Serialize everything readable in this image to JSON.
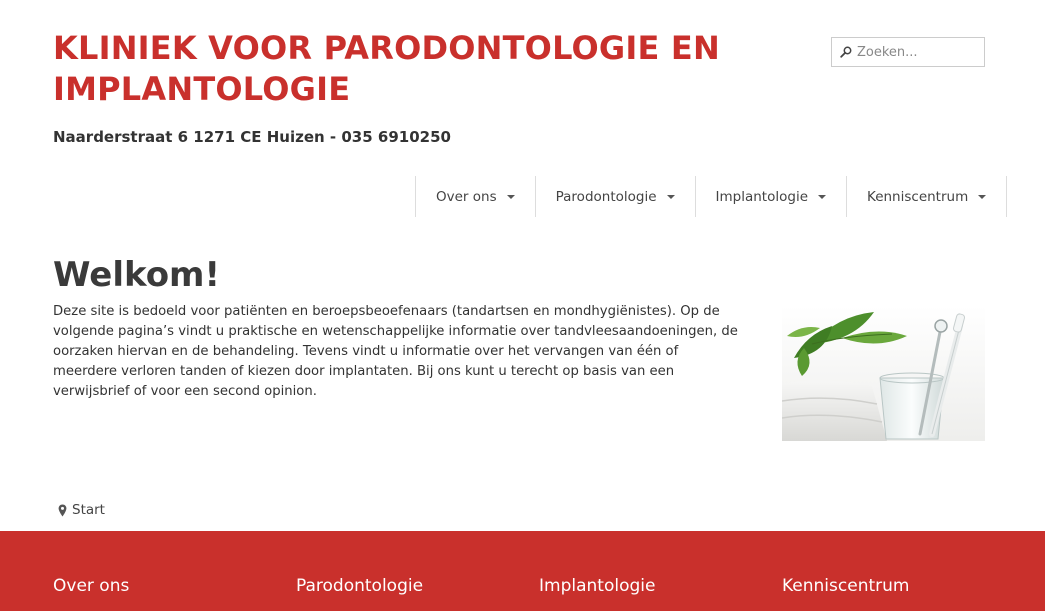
{
  "header": {
    "title": "KLINIEK VOOR PARODONTOLOGIE EN IMPLANTOLOGIE",
    "address": "Naarderstraat 6 1271 CE Huizen - 035 6910250"
  },
  "search": {
    "placeholder": "Zoeken...",
    "icon": "search-icon"
  },
  "nav": {
    "items": [
      {
        "label": "Over ons",
        "icon": "caret-down-icon"
      },
      {
        "label": "Parodontologie",
        "icon": "caret-down-icon"
      },
      {
        "label": "Implantologie",
        "icon": "caret-down-icon"
      },
      {
        "label": "Kenniscentrum",
        "icon": "caret-down-icon"
      }
    ]
  },
  "main": {
    "heading": "Welkom!",
    "intro": "Deze site is bedoeld voor patiënten en beroepsbeoefenaars (tandartsen en mondhygiënistes). Op de volgende pagina’s vindt u praktische en wetenschappelijke informatie over tandvleesaandoeningen, de oorzaken hiervan en de behandeling. Tevens vindt u informatie over het vervangen van één of meerdere verloren tanden of kiezen door implantaten. Bij ons kunt u terecht op basis van een verwijsbrief of voor een second opinion."
  },
  "breadcrumb": {
    "label": "Start",
    "icon": "map-marker-icon"
  },
  "footer": {
    "columns": [
      "Over ons",
      "Parodontologie",
      "Implantologie",
      "Kenniscentrum"
    ]
  },
  "colors": {
    "brand": "#c9302c",
    "text": "#333333",
    "border": "#dddddd"
  }
}
